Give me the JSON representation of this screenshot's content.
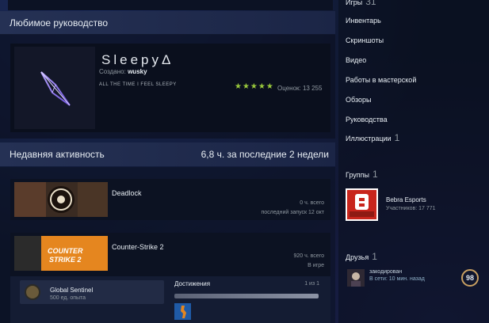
{
  "showcase": {
    "header": "Любимое руководство",
    "guide_title": "SleepyΔ",
    "author_label": "Создано:",
    "author_name": "wusky",
    "description": "ALL THE TIME I FEEL SLEEPY",
    "stars_icon": "★★★★★",
    "rating_text": "Оценок: 13 255"
  },
  "activity": {
    "header": "Недавняя активность",
    "hours_summary": "6,8 ч. за последние 2 недели",
    "games": [
      {
        "name": "Deadlock",
        "line1": "0 ч. всего",
        "line2": "последний запуск 12 окт"
      },
      {
        "name": "Counter-Strike 2",
        "line1": "920 ч. всего",
        "line2": "В игре"
      }
    ],
    "badge": {
      "name": "Global Sentinel",
      "xp": "500 ед. опыта"
    },
    "achievements": {
      "title": "Достижения",
      "count": "1 из 1",
      "progress": 1.0
    }
  },
  "sidebar": {
    "top_label": "Игры",
    "top_count": "31",
    "items": [
      {
        "label": "Инвентарь"
      },
      {
        "label": "Скриншоты"
      },
      {
        "label": "Видео"
      },
      {
        "label": "Работы в мастерской"
      },
      {
        "label": "Обзоры"
      },
      {
        "label": "Руководства"
      },
      {
        "label": "Иллюстрации",
        "count": "1"
      }
    ],
    "groups": {
      "title": "Группы",
      "count": "1",
      "name": "Bebra Esports",
      "members": "Участников: 17 771"
    },
    "friends": {
      "title": "Друзья",
      "count": "1",
      "name": "закодирован",
      "status": "В сети: 10 мин. назад",
      "level": "98"
    }
  },
  "colors": {
    "accent_green": "#98c73c",
    "group_red": "#c8251c",
    "level_ring": "#c9a062"
  }
}
